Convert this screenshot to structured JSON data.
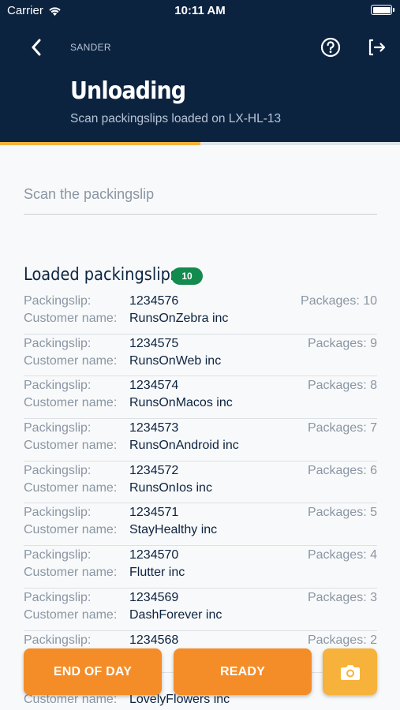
{
  "status_bar": {
    "carrier": "Carrier",
    "time": "10:11 AM"
  },
  "header": {
    "user": "SANDER",
    "title": "Unloading",
    "subtitle": "Scan packingslips loaded on LX-HL-13",
    "icons": {
      "back": "chevron-left-icon",
      "help": "question-circle-icon",
      "logout": "logout-icon"
    }
  },
  "progress": {
    "fraction": 0.5
  },
  "scan": {
    "placeholder": "Scan the packingslip",
    "value": ""
  },
  "list": {
    "title": "Loaded packingslips",
    "count": "10",
    "items": [
      {
        "packingslip_label": "Packingslip:",
        "packingslip": "1234576",
        "customer_label": "Customer name:",
        "customer": "RunsOnZebra inc",
        "packages": "Packages: 10"
      },
      {
        "packingslip_label": "Packingslip:",
        "packingslip": "1234575",
        "customer_label": "Customer name:",
        "customer": "RunsOnWeb inc",
        "packages": "Packages: 9"
      },
      {
        "packingslip_label": "Packingslip:",
        "packingslip": "1234574",
        "customer_label": "Customer name:",
        "customer": "RunsOnMacos inc",
        "packages": "Packages: 8"
      },
      {
        "packingslip_label": "Packingslip:",
        "packingslip": "1234573",
        "customer_label": "Customer name:",
        "customer": "RunsOnAndroid inc",
        "packages": "Packages: 7"
      },
      {
        "packingslip_label": "Packingslip:",
        "packingslip": "1234572",
        "customer_label": "Customer name:",
        "customer": "RunsOnIos inc",
        "packages": "Packages: 6"
      },
      {
        "packingslip_label": "Packingslip:",
        "packingslip": "1234571",
        "customer_label": "Customer name:",
        "customer": "StayHealthy inc",
        "packages": "Packages: 5"
      },
      {
        "packingslip_label": "Packingslip:",
        "packingslip": "1234570",
        "customer_label": "Customer name:",
        "customer": "Flutter inc",
        "packages": "Packages: 4"
      },
      {
        "packingslip_label": "Packingslip:",
        "packingslip": "1234569",
        "customer_label": "Customer name:",
        "customer": "DashForever inc",
        "packages": "Packages: 3"
      },
      {
        "packingslip_label": "Packingslip:",
        "packingslip": "1234568",
        "customer_label": "Customer name:",
        "customer": "",
        "packages": "Packages: 2"
      },
      {
        "packingslip_label": "Packingslip:",
        "packingslip": "",
        "customer_label": "Customer name:",
        "customer": "LovelyFlowers inc",
        "packages": ""
      }
    ]
  },
  "actions": {
    "end_of_day": "END OF DAY",
    "ready": "READY",
    "camera_icon": "camera-icon"
  },
  "colors": {
    "header_bg": "#0c2340",
    "accent_orange": "#f48d27",
    "accent_yellow": "#f7b23b",
    "badge_green": "#138a4e"
  }
}
